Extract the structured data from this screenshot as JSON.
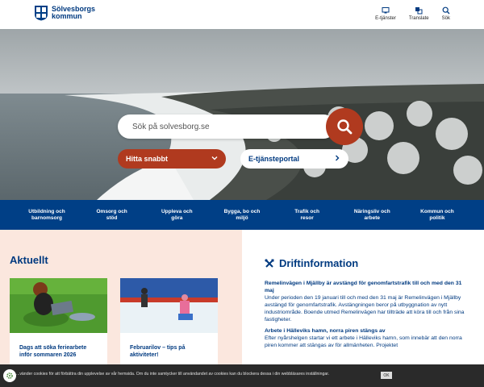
{
  "header": {
    "logo_line1": "Sölvesborgs",
    "logo_line2": "kommun",
    "links": [
      {
        "label": "E-tjänster",
        "icon": "monitor-icon"
      },
      {
        "label": "Translate",
        "icon": "translate-icon"
      },
      {
        "label": "Sök",
        "icon": "search-icon"
      }
    ]
  },
  "hero": {
    "search_placeholder": "Sök på solvesborg.se",
    "quick_label": "Hitta snabbt",
    "eportal_label": "E-tjänsteportal"
  },
  "nav": {
    "items": [
      "Utbildning och\nbarnomsorg",
      "Omsorg och\nstöd",
      "Uppleva och\ngöra",
      "Bygga, bo och\nmiljö",
      "Trafik och\nresor",
      "Näringsliv och\narbete",
      "Kommun och\npolitik"
    ]
  },
  "news": {
    "title": "Aktuellt",
    "cards": [
      {
        "title": "Dags att söka feriearbete inför sommaren 2026"
      },
      {
        "title": "Februarilov – tips på aktiviteter!"
      }
    ]
  },
  "drift": {
    "title": "Driftinformation",
    "items": [
      {
        "heading": "Remelinvägen i Mjällby är avstängd för genomfartstrafik till och med den 31 maj",
        "body": "Under perioden den 19 januari till och med den 31 maj är Remelinvägen i Mjällby avstängd för genomfartstrafik. Avstängningen beror på utbyggnation av nytt industriområde. Boende utmed Remelinvägen har tillträde att köra till och från sina fastigheter."
      },
      {
        "heading": "Arbete i Hälleviks hamn, norra piren stängs av",
        "body": "Efter nyårshelgen startar vi ett arbete i Hälleviks hamn, som innebär att den norra piren kommer att stängas av för allmänheten. Projektet"
      }
    ]
  },
  "cookie": {
    "text": "...vänder cookies för att förbättra din upplevelse av vår hemsida. Om du inte samtycker till användandet av cookies kan du blockera dessa i din webbläsares inställningar.",
    "ok": "OK"
  },
  "colors": {
    "primary": "#003f86",
    "accent": "#b03a1f",
    "news_bg": "#fbe7de"
  }
}
